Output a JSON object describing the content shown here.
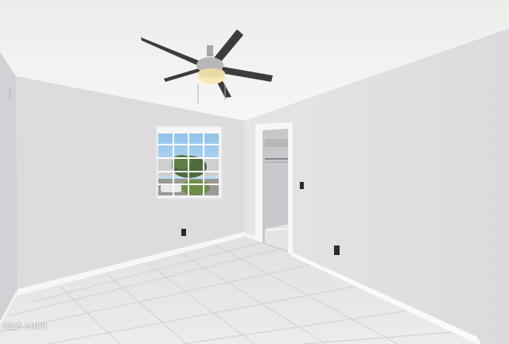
{
  "photo": {
    "subject": "empty-room",
    "watermark": "2025 LHAR"
  },
  "colors": {
    "ceiling": "#f4f4f2",
    "back_wall": "#dedcdf",
    "right_wall": "#e4e2e5",
    "left_wall": "#d2d0d4",
    "floor": "#e9e6e7",
    "baseboard": "#ffffff",
    "fan_blade": "#3e3b3d",
    "fan_light": "#f6e8b8"
  }
}
